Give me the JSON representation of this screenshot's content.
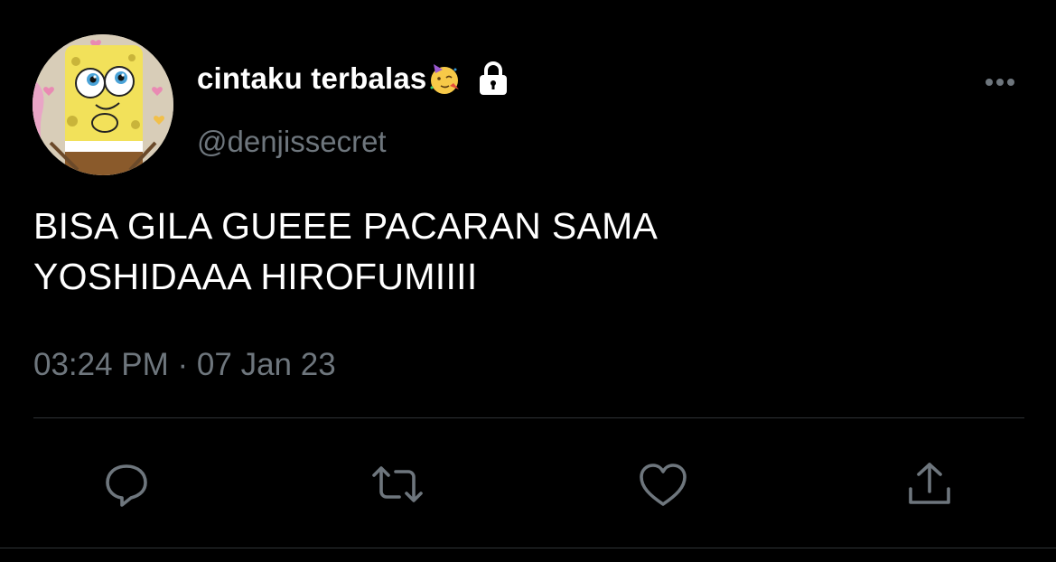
{
  "tweet": {
    "display_name": "cintaku terbalas",
    "handle": "@denjissecret",
    "text_line1": "BISA GILA GUEEE PACARAN SAMA",
    "text_line2": "YOSHIDAAA HIROFUMIIII",
    "timestamp": "03:24 PM · 07 Jan 23"
  },
  "icons": {
    "display_name_emoji": "partying-face-emoji",
    "protected": "lock-icon",
    "more": "more-horizontal-icon",
    "reply": "reply-icon",
    "retweet": "retweet-icon",
    "like": "like-heart-icon",
    "share": "share-icon"
  },
  "colors": {
    "background": "#000000",
    "primary_text": "#ffffff",
    "secondary_text": "#6e767d",
    "divider": "#2f3336"
  }
}
